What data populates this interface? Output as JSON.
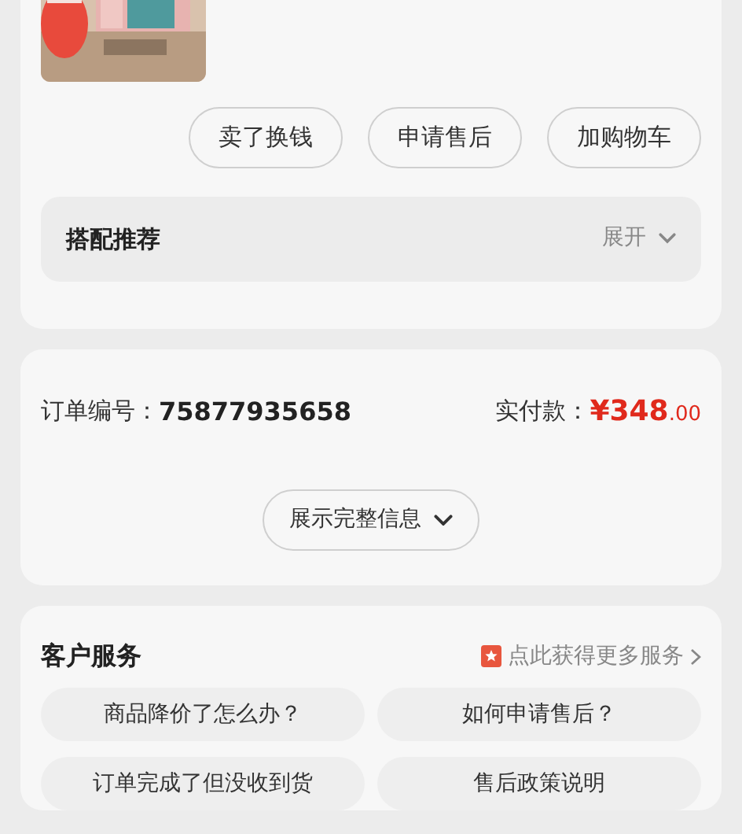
{
  "product": {
    "image": {
      "kind": "picture"
    }
  },
  "actions": [
    "卖了换钱",
    "申请售后",
    "加购物车"
  ],
  "recommend": {
    "title": "搭配推荐",
    "toggle": "展开",
    "expanded": false
  },
  "order": {
    "number_label": "订单编号：",
    "number": "75877935658",
    "paid_label": "实付款：",
    "currency": "¥",
    "amount": "348",
    "decimals": ".00",
    "more": "展示完整信息"
  },
  "service": {
    "title": "客户服务",
    "link": "点此获得更多服务",
    "questions": [
      "商品降价了怎么办？",
      "如何申请售后？",
      "订单完成了但没收到货",
      "售后政策说明"
    ]
  }
}
